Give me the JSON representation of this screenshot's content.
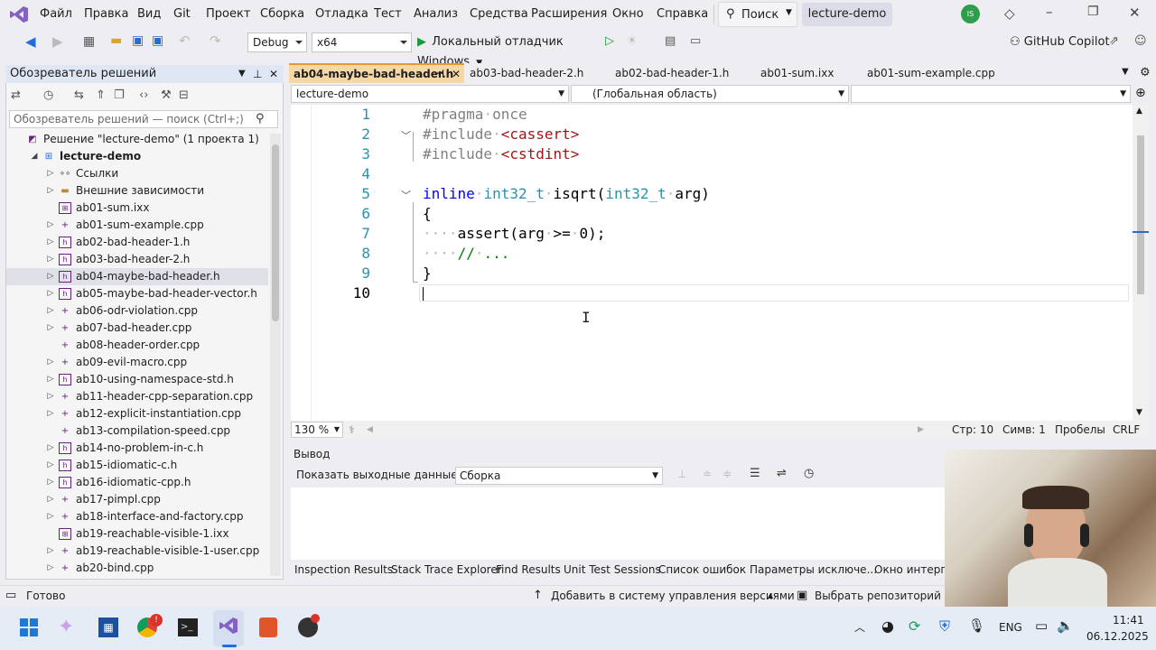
{
  "menubar": {
    "items": [
      "Файл",
      "Правка",
      "Вид",
      "Git",
      "Проект",
      "Сборка",
      "Отладка",
      "Тест",
      "Анализ",
      "Средства",
      "Расширения",
      "Окно",
      "Справка"
    ],
    "search_label": "Поиск",
    "solution_name": "lecture-demo",
    "avatar_initials": "IS"
  },
  "toolbar": {
    "config": "Debug",
    "platform": "x64",
    "run_label": "Локальный отладчик Windows",
    "copilot_label": "GitHub Copilot"
  },
  "solution_explorer": {
    "title": "Обозреватель решений",
    "search_placeholder": "Обозреватель решений — поиск (Ctrl+;)",
    "items": [
      {
        "label": "Решение \"lecture-demo\"  (1 проекта 1)",
        "icon": "solution-icon",
        "expander": ""
      },
      {
        "label": "lecture-demo",
        "icon": "project-icon",
        "expander": "expanded",
        "bold": true
      },
      {
        "label": "Ссылки",
        "icon": "references-icon",
        "expander": "collapsed"
      },
      {
        "label": "Внешние зависимости",
        "icon": "folder-icon",
        "expander": "collapsed"
      },
      {
        "label": "ab01-sum.ixx",
        "icon": "module-file-icon",
        "expander": ""
      },
      {
        "label": "ab01-sum-example.cpp",
        "icon": "cpp-file-icon",
        "expander": "collapsed"
      },
      {
        "label": "ab02-bad-header-1.h",
        "icon": "header-file-icon",
        "expander": "collapsed"
      },
      {
        "label": "ab03-bad-header-2.h",
        "icon": "header-file-icon",
        "expander": "collapsed"
      },
      {
        "label": "ab04-maybe-bad-header.h",
        "icon": "header-file-icon",
        "expander": "collapsed",
        "selected": true
      },
      {
        "label": "ab05-maybe-bad-header-vector.h",
        "icon": "header-file-icon",
        "expander": "collapsed"
      },
      {
        "label": "ab06-odr-violation.cpp",
        "icon": "cpp-file-icon",
        "expander": "collapsed"
      },
      {
        "label": "ab07-bad-header.cpp",
        "icon": "cpp-file-icon",
        "expander": "collapsed"
      },
      {
        "label": "ab08-header-order.cpp",
        "icon": "cpp-file-icon",
        "expander": ""
      },
      {
        "label": "ab09-evil-macro.cpp",
        "icon": "cpp-file-icon",
        "expander": "collapsed"
      },
      {
        "label": "ab10-using-namespace-std.h",
        "icon": "header-file-icon",
        "expander": "collapsed"
      },
      {
        "label": "ab11-header-cpp-separation.cpp",
        "icon": "cpp-file-icon",
        "expander": "collapsed"
      },
      {
        "label": "ab12-explicit-instantiation.cpp",
        "icon": "cpp-file-icon",
        "expander": "collapsed"
      },
      {
        "label": "ab13-compilation-speed.cpp",
        "icon": "cpp-file-icon",
        "expander": ""
      },
      {
        "label": "ab14-no-problem-in-c.h",
        "icon": "header-file-icon",
        "expander": "collapsed"
      },
      {
        "label": "ab15-idiomatic-c.h",
        "icon": "header-file-icon",
        "expander": "collapsed"
      },
      {
        "label": "ab16-idiomatic-cpp.h",
        "icon": "header-file-icon",
        "expander": "collapsed"
      },
      {
        "label": "ab17-pimpl.cpp",
        "icon": "cpp-file-icon",
        "expander": "collapsed"
      },
      {
        "label": "ab18-interface-and-factory.cpp",
        "icon": "cpp-file-icon",
        "expander": "collapsed"
      },
      {
        "label": "ab19-reachable-visible-1.ixx",
        "icon": "module-file-icon",
        "expander": ""
      },
      {
        "label": "ab19-reachable-visible-1-user.cpp",
        "icon": "cpp-file-icon",
        "expander": "collapsed"
      },
      {
        "label": "ab20-bind.cpp",
        "icon": "cpp-file-icon",
        "expander": "collapsed"
      }
    ]
  },
  "tabs": [
    {
      "label": "ab04-maybe-bad-header.h",
      "active": true
    },
    {
      "label": "ab03-bad-header-2.h"
    },
    {
      "label": "ab02-bad-header-1.h"
    },
    {
      "label": "ab01-sum.ixx"
    },
    {
      "label": "ab01-sum-example.cpp"
    }
  ],
  "navbar": {
    "project": "lecture-demo",
    "scope": "(Глобальная область)",
    "member": ""
  },
  "editor": {
    "line_numbers": [
      "1",
      "2",
      "3",
      "4",
      "5",
      "6",
      "7",
      "8",
      "9",
      "10"
    ],
    "lines": [
      "#pragma·once",
      "#include·<cassert>",
      "#include·<cstdint>",
      "",
      "inline·int32_t·isqrt(int32_t·arg)",
      "{",
      "····assert(arg·>=·0);",
      "····//·...",
      "}",
      ""
    ],
    "zoom": "130 %",
    "status_line": "Стр: 10",
    "status_col": "Симв: 1",
    "status_ws": "Пробелы",
    "status_eol": "CRLF"
  },
  "output": {
    "title": "Вывод",
    "show_from_label": "Показать выходные данные из:",
    "source": "Сборка"
  },
  "bottom_tabs": [
    "Inspection Results",
    "Stack Trace Explorer",
    "Find Results",
    "Unit Test Sessions",
    "Список ошибок",
    "Параметры исключе...",
    "Окно интерпр"
  ],
  "statusbar": {
    "ready": "Готово",
    "add_vcs": "Добавить в систему управления версиями",
    "select_repo": "Выбрать репозиторий"
  },
  "taskbar": {
    "lang": "ENG",
    "time": "11:41",
    "date": "06.12.2025"
  },
  "colors": {
    "keyword": "#0000ff",
    "type": "#2b91af",
    "string": "#a31515",
    "preproc": "#808080",
    "accent": "#68217a"
  }
}
